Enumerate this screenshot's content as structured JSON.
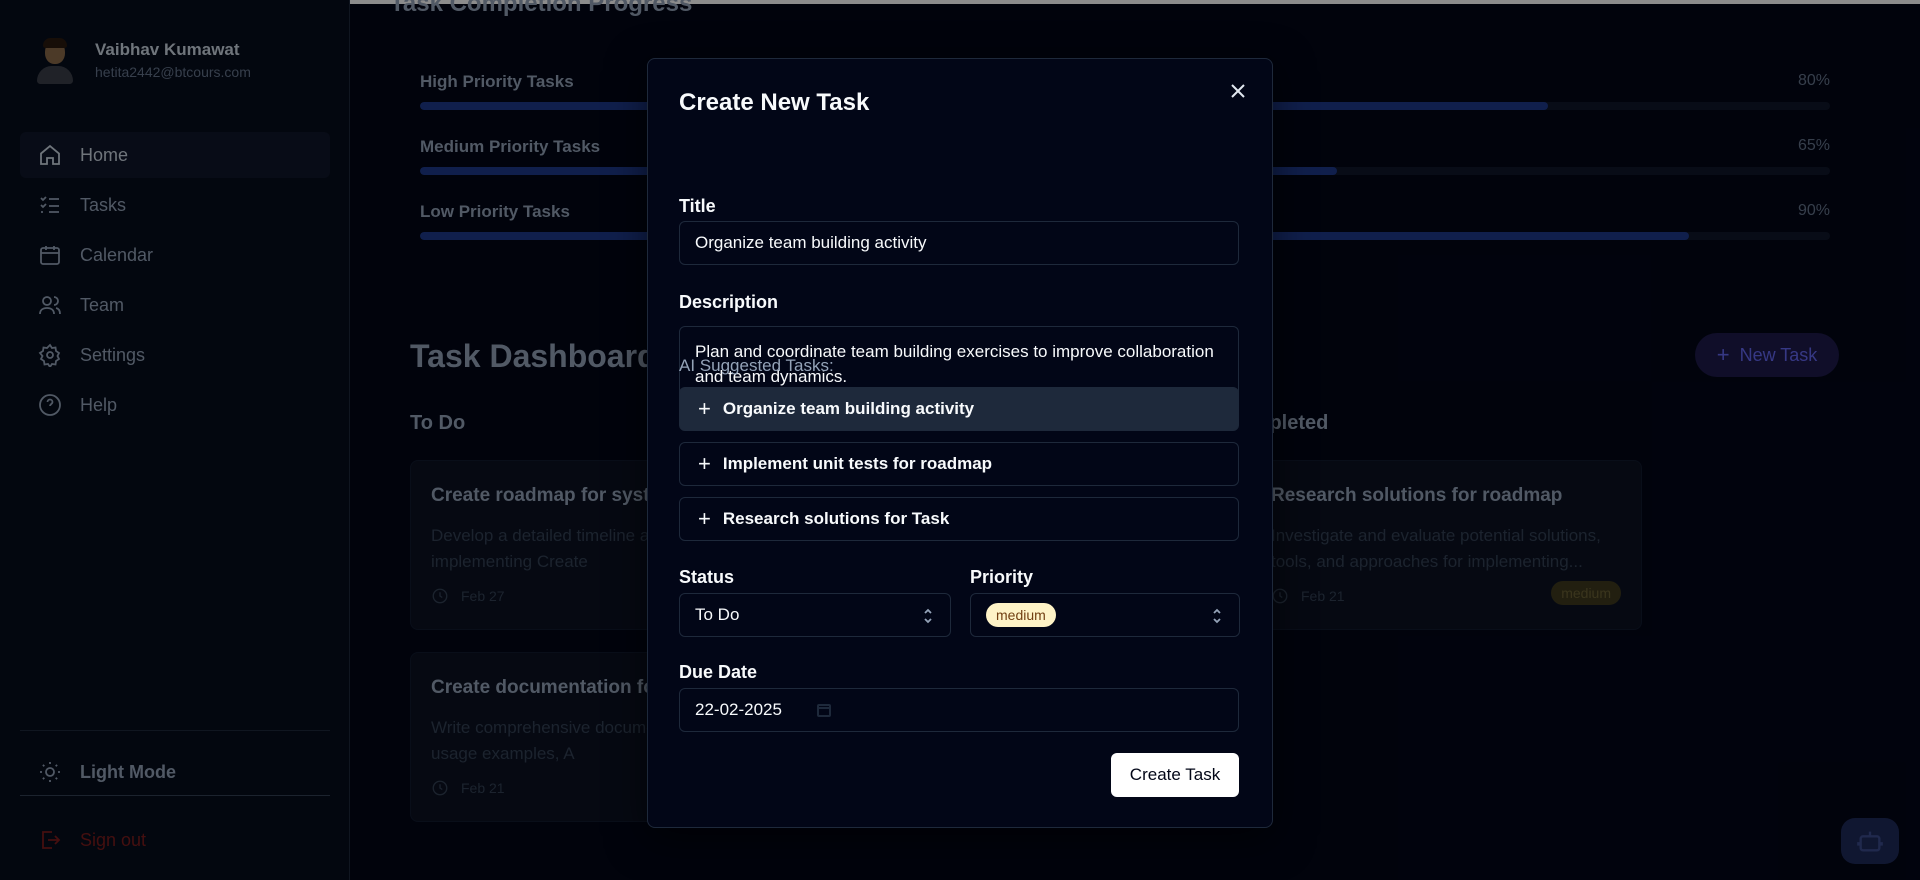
{
  "sidebar": {
    "user": {
      "name": "Vaibhav Kumawat",
      "email": "hetita2442@btcours.com"
    },
    "nav": [
      {
        "label": "Home",
        "icon": "home-icon"
      },
      {
        "label": "Tasks",
        "icon": "list-check-icon"
      },
      {
        "label": "Calendar",
        "icon": "calendar-icon"
      },
      {
        "label": "Team",
        "icon": "users-icon"
      },
      {
        "label": "Settings",
        "icon": "gear-icon"
      },
      {
        "label": "Help",
        "icon": "help-circle-icon"
      }
    ],
    "light_mode": "Light Mode",
    "sign_out": "Sign out"
  },
  "main": {
    "progress_title": "Task Completion Progress",
    "progress": [
      {
        "label": "High Priority Tasks",
        "percent_label": "80%",
        "value": 0.8
      },
      {
        "label": "Medium Priority Tasks",
        "percent_label": "65%",
        "value": 0.65
      },
      {
        "label": "Low Priority Tasks",
        "percent_label": "90%",
        "value": 0.9
      }
    ],
    "dashboard_title": "Task Dashboard",
    "new_task": "New Task",
    "columns": {
      "todo": "To Do",
      "completed": "Completed"
    },
    "cards": [
      {
        "title": "Create roadmap for system",
        "desc": "Develop a detailed timeline and plan for implementing Create",
        "date": "Feb 27"
      },
      {
        "title": "Create documentation for",
        "desc": "Write comprehensive documentation including usage examples, A",
        "date": "Feb 21"
      },
      {
        "title": "Research solutions for roadmap",
        "desc": "Investigate and evaluate potential solutions, tools, and approaches for implementing...",
        "date": "Feb 21",
        "badge": "medium"
      }
    ]
  },
  "modal": {
    "title": "Create New Task",
    "title_label": "Title",
    "title_value": "Organize team building activity",
    "description_label": "Description",
    "description_value": "Plan and coordinate team building exercises to improve collaboration and team dynamics.",
    "ai_label": "AI Suggested Tasks:",
    "ai_suggestions": [
      "Organize team building activity",
      "Implement unit tests for roadmap",
      "Research solutions for Task"
    ],
    "status_label": "Status",
    "status_value": "To Do",
    "priority_label": "Priority",
    "priority_value": "medium",
    "due_label": "Due Date",
    "due_value": "22-02-2025",
    "submit": "Create Task"
  },
  "colors": {
    "accent": "#1e3a8a",
    "priority_medium_bg": "#fef3c7",
    "sign_out": "#7f1d1d"
  }
}
